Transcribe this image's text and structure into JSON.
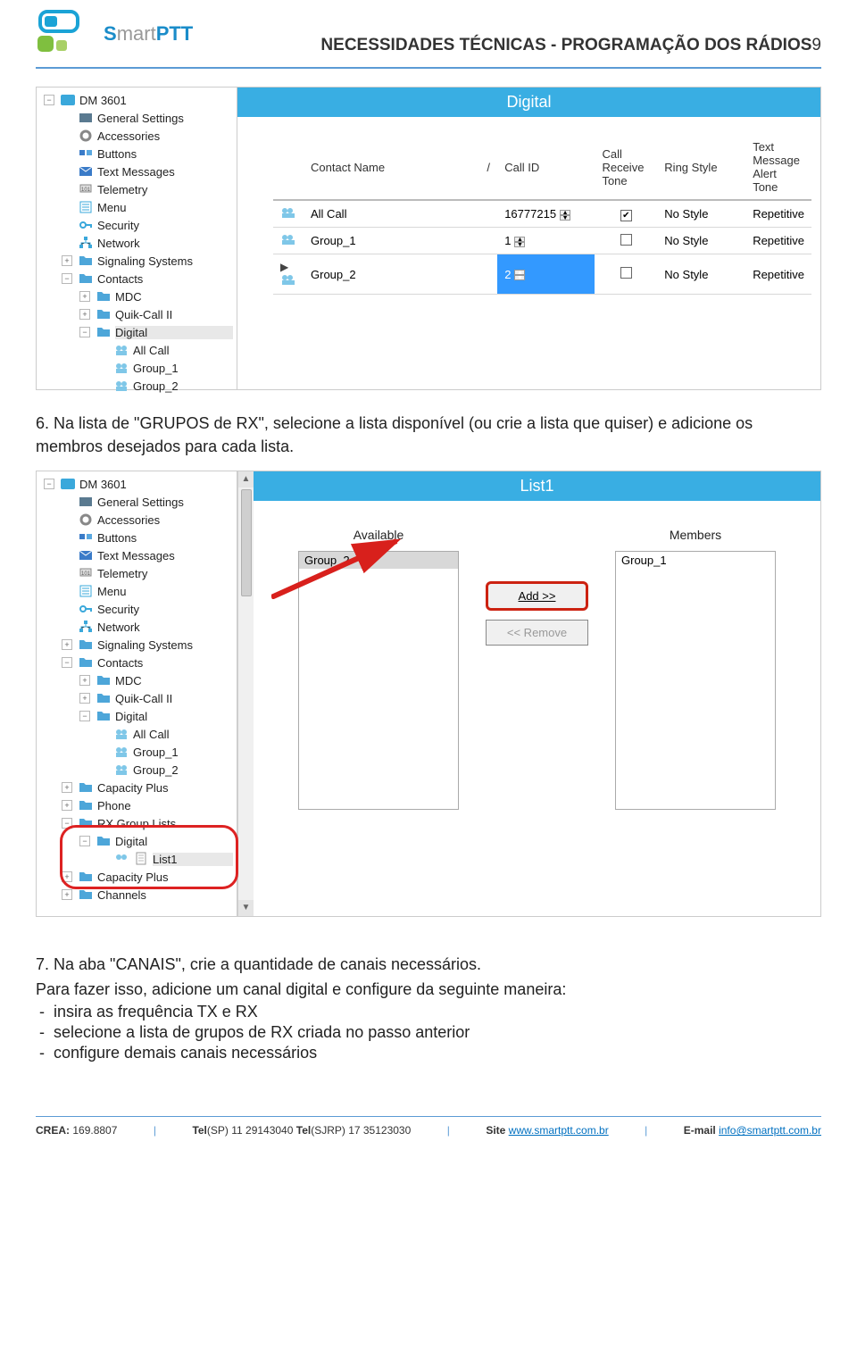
{
  "header": {
    "logo_text_1": "S",
    "logo_text_2": "mart",
    "logo_text_3": "PTT",
    "title": "NECESSIDADES TÉCNICAS - PROGRAMAÇÃO DOS RÁDIOS",
    "page_num": "9"
  },
  "s1": {
    "root": "DM 3601",
    "items": [
      "General Settings",
      "Accessories",
      "Buttons",
      "Text Messages",
      "Telemetry",
      "Menu",
      "Security",
      "Network",
      "Signaling Systems",
      "Contacts"
    ],
    "contacts": {
      "children": [
        "MDC",
        "Quik-Call II",
        "Digital"
      ],
      "digital_children": [
        "All Call",
        "Group_1",
        "Group_2"
      ]
    },
    "selected": "Digital",
    "pane_title": "Digital",
    "cols": [
      "Contact Name",
      "Call ID",
      "Call Receive Tone",
      "Ring Style",
      "Text Message Alert Tone"
    ],
    "slash": "/",
    "rows": [
      {
        "name": "All Call",
        "id": "16777215",
        "crt": true,
        "ring": "No Style",
        "tone": "Repetitive"
      },
      {
        "name": "Group_1",
        "id": "1",
        "crt": false,
        "ring": "No Style",
        "tone": "Repetitive"
      },
      {
        "name": "Group_2",
        "id": "2",
        "crt": false,
        "ring": "No Style",
        "tone": "Repetitive",
        "selected": true
      }
    ]
  },
  "instr6": "6. Na lista de \"GRUPOS de RX\", selecione a lista disponível (ou crie a lista que quiser) e adicione os membros desejados para cada lista.",
  "s2": {
    "root": "DM 3601",
    "items": [
      "General Settings",
      "Accessories",
      "Buttons",
      "Text Messages",
      "Telemetry",
      "Menu",
      "Security",
      "Network",
      "Signaling Systems",
      "Contacts"
    ],
    "contacts": {
      "children": [
        "MDC",
        "Quik-Call II",
        "Digital"
      ],
      "digital_children": [
        "All Call",
        "Group_1",
        "Group_2"
      ]
    },
    "extra": [
      "Capacity Plus",
      "Phone",
      "RX Group Lists"
    ],
    "rxg": {
      "child": "Digital",
      "leaf": "List1"
    },
    "after": [
      "Capacity Plus",
      "Channels"
    ],
    "selected": "List1",
    "pane_title": "List1",
    "available_label": "Available",
    "members_label": "Members",
    "available_item": "Group_2",
    "members_item": "Group_1",
    "btn_add": "Add >>",
    "btn_remove": "<< Remove"
  },
  "instr7": "7. Na aba \"CANAIS\", crie a quantidade de canais necessários.",
  "instr7b": "Para fazer isso, adicione um canal digital e configure da seguinte maneira:",
  "bullets": [
    "insira as frequência TX e RX",
    "selecione a lista de grupos de RX criada no passo anterior",
    "configure demais canais necessários"
  ],
  "footer": {
    "crea_lbl": "CREA:",
    "crea": "169.8807",
    "tel_sp_lbl": "Tel",
    "tel_sp": "(SP) 11 29143040",
    "tel_sjrp": "(SJRP) 17 35123030",
    "site_lbl": "Site",
    "site": "www.smartptt.com.br",
    "email_lbl": "E-mail",
    "email": "info@smartptt.com.br",
    "sep": "|"
  },
  "icons": {
    "radio": "#3aa8db",
    "gear": "#555",
    "folder": "#4da6d9",
    "person": "#4da6d9",
    "msg": "#3a7bc8",
    "tel": "#666",
    "menu": "#3aa8db",
    "key": "#3aa8db",
    "net": "#3aa8db",
    "contact": "#3aa8db",
    "group": "#7fc7e8",
    "doc": "#ccc"
  }
}
